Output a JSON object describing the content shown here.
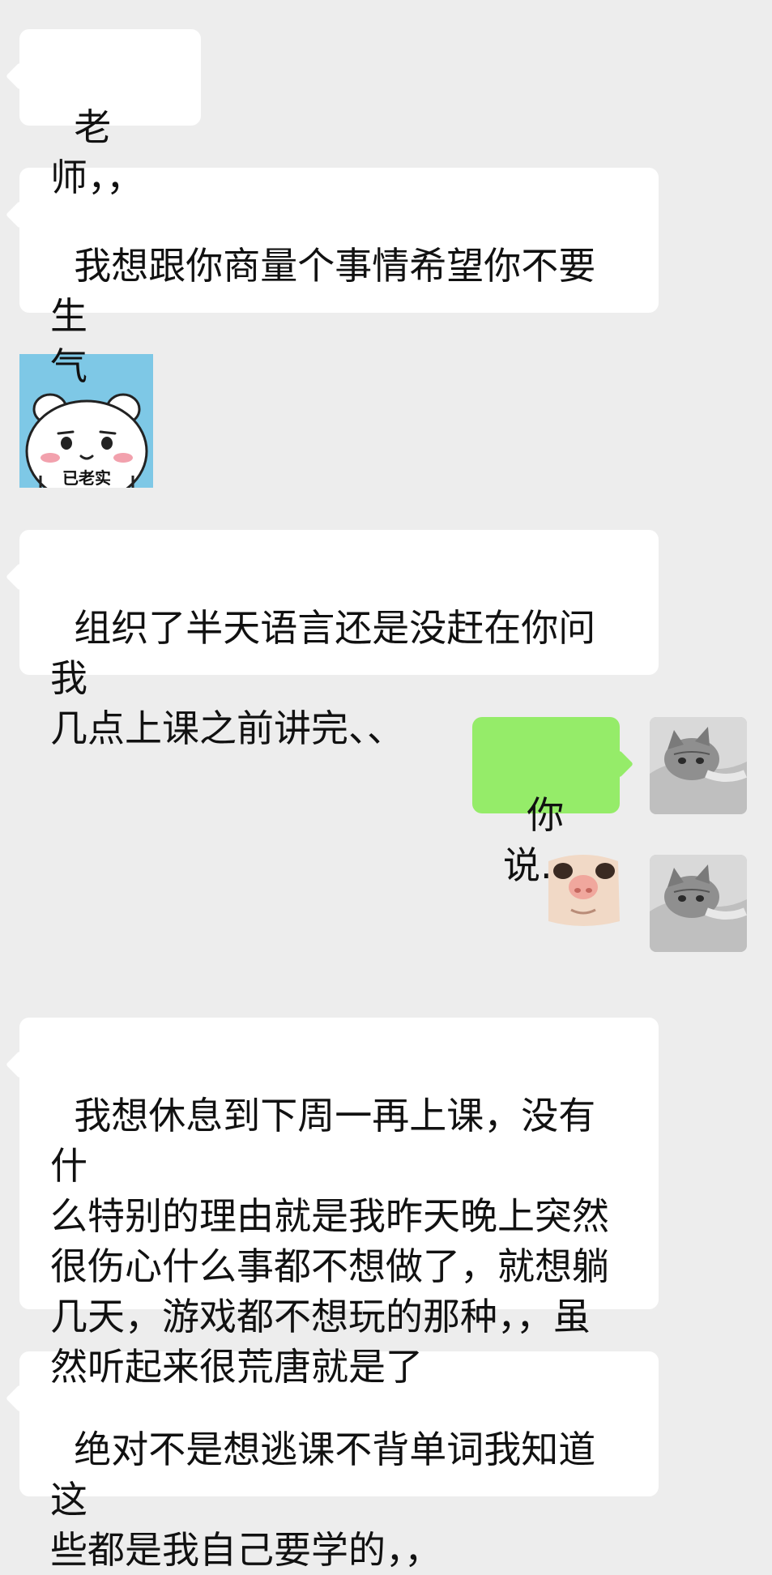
{
  "chat": {
    "messages": [
      {
        "side": "left",
        "type": "text",
        "text": "老师，，"
      },
      {
        "side": "left",
        "type": "text",
        "text": "我想跟你商量个事情希望你不要生\n气"
      },
      {
        "side": "left",
        "type": "sticker",
        "caption": "已老实"
      },
      {
        "side": "left",
        "type": "text",
        "text": "组织了半天语言还是没赶在你问我\n几点上课之前讲完、、"
      },
      {
        "side": "right",
        "type": "text",
        "text": "你说."
      },
      {
        "side": "right",
        "type": "sticker"
      },
      {
        "side": "left",
        "type": "text",
        "text": "我想休息到下周一再上课，没有什\n么特别的理由就是我昨天晚上突然\n很伤心什么事都不想做了，就想躺\n几天，游戏都不想玩的那种，，虽\n然听起来很荒唐就是了"
      },
      {
        "side": "left",
        "type": "text",
        "text": "绝对不是想逃课不背单词我知道这\n些都是我自己要学的，，"
      }
    ]
  },
  "colors": {
    "background": "#ededed",
    "bubble_left": "#ffffff",
    "bubble_right": "#95ec69",
    "text": "#111111"
  }
}
